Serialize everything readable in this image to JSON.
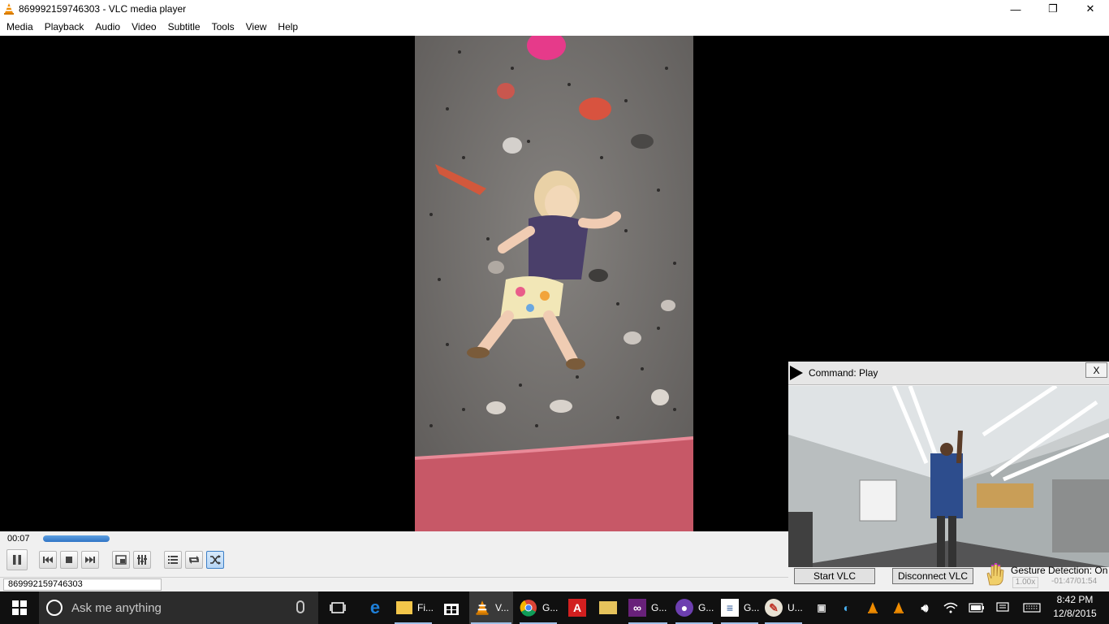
{
  "window": {
    "title": "869992159746303 - VLC media player",
    "controls": {
      "minimize": "—",
      "maximize": "❐",
      "close": "✕"
    }
  },
  "menu": [
    "Media",
    "Playback",
    "Audio",
    "Video",
    "Subtitle",
    "Tools",
    "View",
    "Help"
  ],
  "player": {
    "elapsed": "00:07",
    "progress_fraction": 0.09,
    "status_text": "869992159746303",
    "buttons": [
      "pause-icon",
      "previous-icon",
      "stop-icon",
      "next-icon",
      "fullscreen-icon",
      "extended-settings-icon",
      "playlist-icon",
      "loop-icon",
      "random-icon"
    ],
    "random_active": true
  },
  "gesture_window": {
    "command": "Command: Play",
    "close_label": "X",
    "start_label": "Start VLC",
    "disconnect_label": "Disconnect VLC",
    "status": "Gesture Detection: On",
    "speed": "1.00x",
    "time": "-01:47/01:54"
  },
  "taskbar": {
    "search_placeholder": "Ask me anything",
    "items": [
      {
        "icon": "task-view-icon",
        "label": ""
      },
      {
        "icon": "edge-icon",
        "label": ""
      },
      {
        "icon": "file-explorer-icon",
        "label": "Fi..."
      },
      {
        "icon": "store-icon",
        "label": ""
      },
      {
        "icon": "vlc-icon",
        "label": "V..."
      },
      {
        "icon": "chrome-icon",
        "label": "G..."
      },
      {
        "icon": "acrobat-icon",
        "label": ""
      },
      {
        "icon": "folder-icon",
        "label": ""
      },
      {
        "icon": "visual-studio-icon",
        "label": "G..."
      },
      {
        "icon": "app-icon",
        "label": "G..."
      },
      {
        "icon": "document-icon",
        "label": "G..."
      },
      {
        "icon": "paint-icon",
        "label": "U..."
      }
    ],
    "tray": [
      "network-adapter-icon",
      "app-tray-icon",
      "vlc-tray-icon",
      "vlc-tray-icon-2",
      "volume-icon",
      "wifi-icon",
      "battery-icon",
      "notifications-icon",
      "keyboard-icon"
    ],
    "time": "8:42 PM",
    "date": "12/8/2015"
  },
  "colors": {
    "accent": "#2f74c6",
    "taskbar": "#101010",
    "vlc_orange": "#f08c00"
  }
}
